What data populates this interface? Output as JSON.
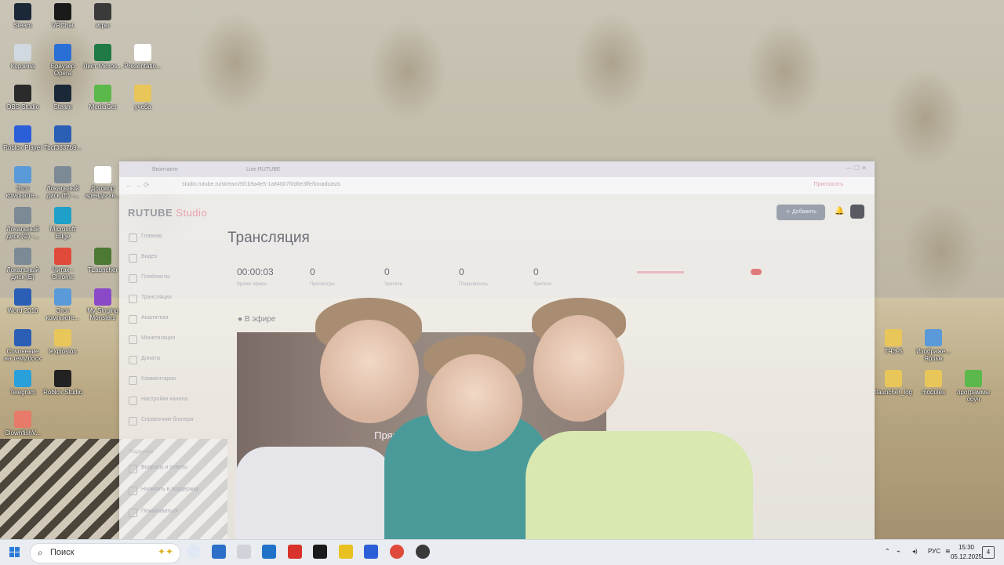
{
  "desktop_icons": [
    {
      "label": "Steam",
      "col": 0,
      "row": 0,
      "color": "#1b2838"
    },
    {
      "label": "VRChat",
      "col": 1,
      "row": 0,
      "color": "#1a1a1a"
    },
    {
      "label": "игры",
      "col": 2,
      "row": 0,
      "color": "#3a3a3a"
    },
    {
      "label": "Корзина",
      "col": 0,
      "row": 1,
      "color": "#d0d8e0"
    },
    {
      "label": "Браузер Opera",
      "col": 1,
      "row": 1,
      "color": "#2a6fd6"
    },
    {
      "label": "Лист Micros...",
      "col": 2,
      "row": 1,
      "color": "#1f7a45"
    },
    {
      "label": "Presentatio...",
      "col": 3,
      "row": 1,
      "color": "#ffffff"
    },
    {
      "label": "OBS Studio",
      "col": 0,
      "row": 2,
      "color": "#2b2b2b"
    },
    {
      "label": "Steam",
      "col": 1,
      "row": 2,
      "color": "#1b2838"
    },
    {
      "label": "MediaGet",
      "col": 2,
      "row": 2,
      "color": "#5bb84b"
    },
    {
      "label": "учеба",
      "col": 3,
      "row": 2,
      "color": "#e8c65a"
    },
    {
      "label": "Roblox Player",
      "col": 0,
      "row": 3,
      "color": "#2a5fd8"
    },
    {
      "label": "7bcf3837b9...",
      "col": 1,
      "row": 3,
      "color": "#2b5fb5"
    },
    {
      "label": "Этот компьюте...",
      "col": 0,
      "row": 4,
      "color": "#5a9ad8"
    },
    {
      "label": "Локальный диск (E) -...",
      "col": 1,
      "row": 4,
      "color": "#7c8a96"
    },
    {
      "label": "Договор аренды кв...",
      "col": 2,
      "row": 4,
      "color": "#ffffff"
    },
    {
      "label": "Локальный диск (C) -...",
      "col": 0,
      "row": 5,
      "color": "#7c8a96"
    },
    {
      "label": "Microsoft Edge",
      "col": 1,
      "row": 5,
      "color": "#1fa0c8"
    },
    {
      "label": "Локальный диск (E)",
      "col": 0,
      "row": 6,
      "color": "#7c8a96"
    },
    {
      "label": "Читак - Chrome",
      "col": 1,
      "row": 6,
      "color": "#e04a3a"
    },
    {
      "label": "TLauncher",
      "col": 2,
      "row": 6,
      "color": "#4c7a34"
    },
    {
      "label": "Word 2016",
      "col": 0,
      "row": 7,
      "color": "#2b5fb5"
    },
    {
      "label": "Этот компьюте...",
      "col": 1,
      "row": 7,
      "color": "#5a9ad8"
    },
    {
      "label": "My Singing Monsters",
      "col": 2,
      "row": 7,
      "color": "#8a4ac8"
    },
    {
      "label": "Сочинение на тему.docx",
      "col": 0,
      "row": 8,
      "color": "#2b5fb5"
    },
    {
      "label": "lexplosion",
      "col": 1,
      "row": 8,
      "color": "#e8c65a"
    },
    {
      "label": "Telegram",
      "col": 0,
      "row": 9,
      "color": "#2aa0da"
    },
    {
      "label": "Roblox Studio",
      "col": 1,
      "row": 9,
      "color": "#222222"
    },
    {
      "label": "ClownfishV...",
      "col": 0,
      "row": 10,
      "color": "#e87a6a"
    }
  ],
  "right_icons": [
    {
      "label": "ТЧЭ-5",
      "slot": 0,
      "color": "#e8c65a"
    },
    {
      "label": "Изображе... Ярлык",
      "slot": 1,
      "color": "#5a9ad8"
    },
    {
      "label": "tlauncher_log",
      "slot": 2,
      "color": "#e8c65a"
    },
    {
      "label": "modules",
      "slot": 3,
      "color": "#e8c65a"
    },
    {
      "label": "программы обуч",
      "slot": 4,
      "color": "#5bb84b"
    }
  ],
  "browser": {
    "tabs": [
      "Вконтакте",
      "Live RUTUBE"
    ],
    "address": "studio.rutube.ru/stream/5f1b9a4e5-1a84007f0d6e3ffe/broadcasts",
    "profile_label": "Пригласить",
    "logo": "RUTUBE",
    "logo_suffix": "Studio",
    "add_button": "Добавить",
    "sidebar": [
      "Главная",
      "Видео",
      "Плейлисты",
      "Трансляции",
      "Аналитика",
      "Монетизация",
      "Донаты",
      "Комментарии",
      "Настройки канала",
      "Справочник блогера"
    ],
    "sidebar_section": "Поддержка",
    "sidebar_support": [
      "Вопросы и ответы",
      "Написать в поддержку",
      "Пожаловаться"
    ],
    "page_title": "Трансляция",
    "stats": [
      {
        "value": "00:00:03",
        "label": "Время эфира"
      },
      {
        "value": "0",
        "label": "Просмотры"
      },
      {
        "value": "0",
        "label": "Зрители"
      },
      {
        "value": "0",
        "label": "Понравилось"
      },
      {
        "value": "0",
        "label": "Зрители"
      }
    ],
    "on_air": "В эфире",
    "video_label": "Прямая трансляция"
  },
  "taskbar": {
    "search_placeholder": "Поиск",
    "language": "РУС",
    "time": "15:30",
    "date": "05.12.2025",
    "notifications": "4"
  }
}
